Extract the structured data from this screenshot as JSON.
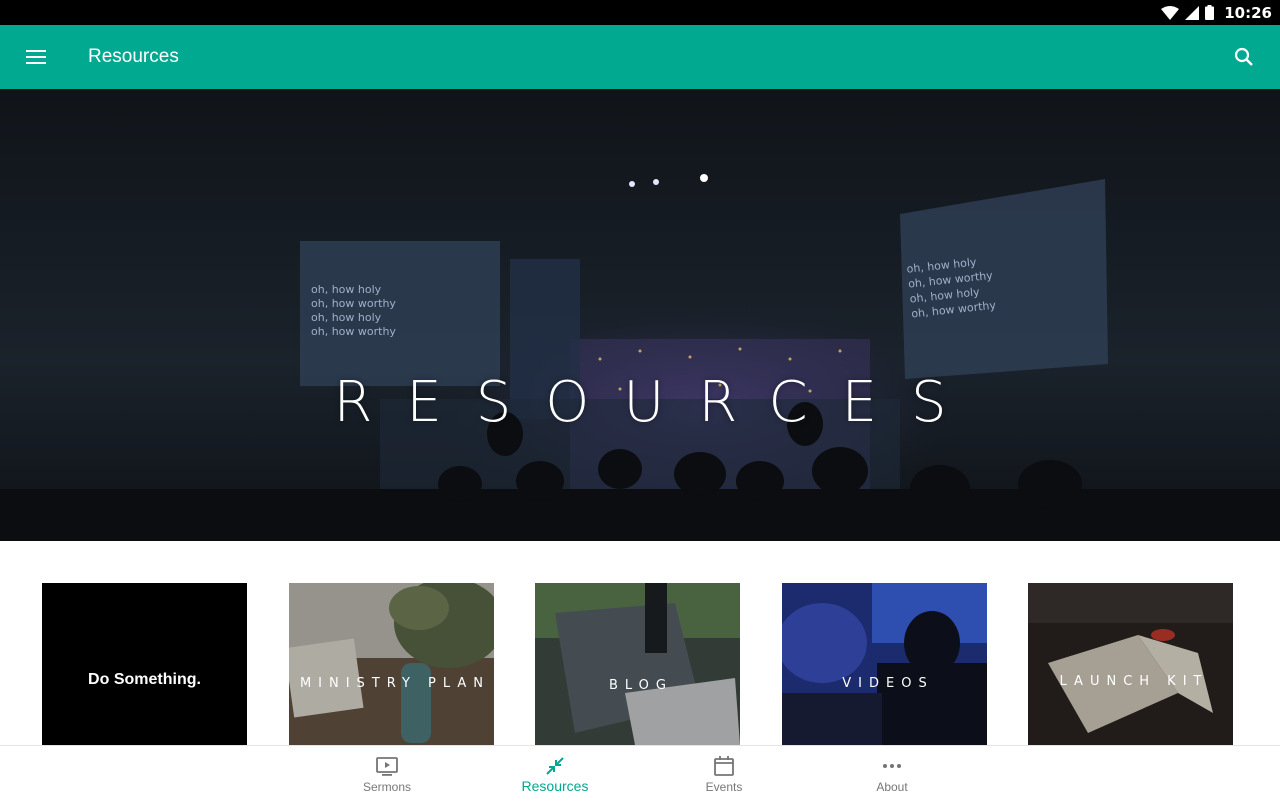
{
  "status_bar": {
    "time": "10:26"
  },
  "app_bar": {
    "title": "Resources"
  },
  "hero": {
    "title": "RESOURCES",
    "screen_left_lines": [
      "oh, how holy",
      "oh, how worthy",
      "oh, how holy",
      "oh, how worthy"
    ],
    "screen_right_lines": [
      "oh, how holy",
      "oh, how worthy",
      "oh, how holy",
      "oh, how worthy"
    ]
  },
  "cards": [
    {
      "label": "Do Something."
    },
    {
      "label": "MINISTRY PLAN"
    },
    {
      "label": "BLOG"
    },
    {
      "label": "VIDEOS"
    },
    {
      "label": "LAUNCH KIT"
    }
  ],
  "bottom_nav": {
    "items": [
      {
        "label": "Sermons",
        "icon": "video-icon"
      },
      {
        "label": "Resources",
        "icon": "collapse-arrows-icon",
        "active": true
      },
      {
        "label": "Events",
        "icon": "calendar-icon"
      },
      {
        "label": "About",
        "icon": "more-dots-icon"
      }
    ]
  },
  "colors": {
    "accent": "#00a98f",
    "status_bar": "#000000",
    "nav_inactive": "#777777"
  }
}
